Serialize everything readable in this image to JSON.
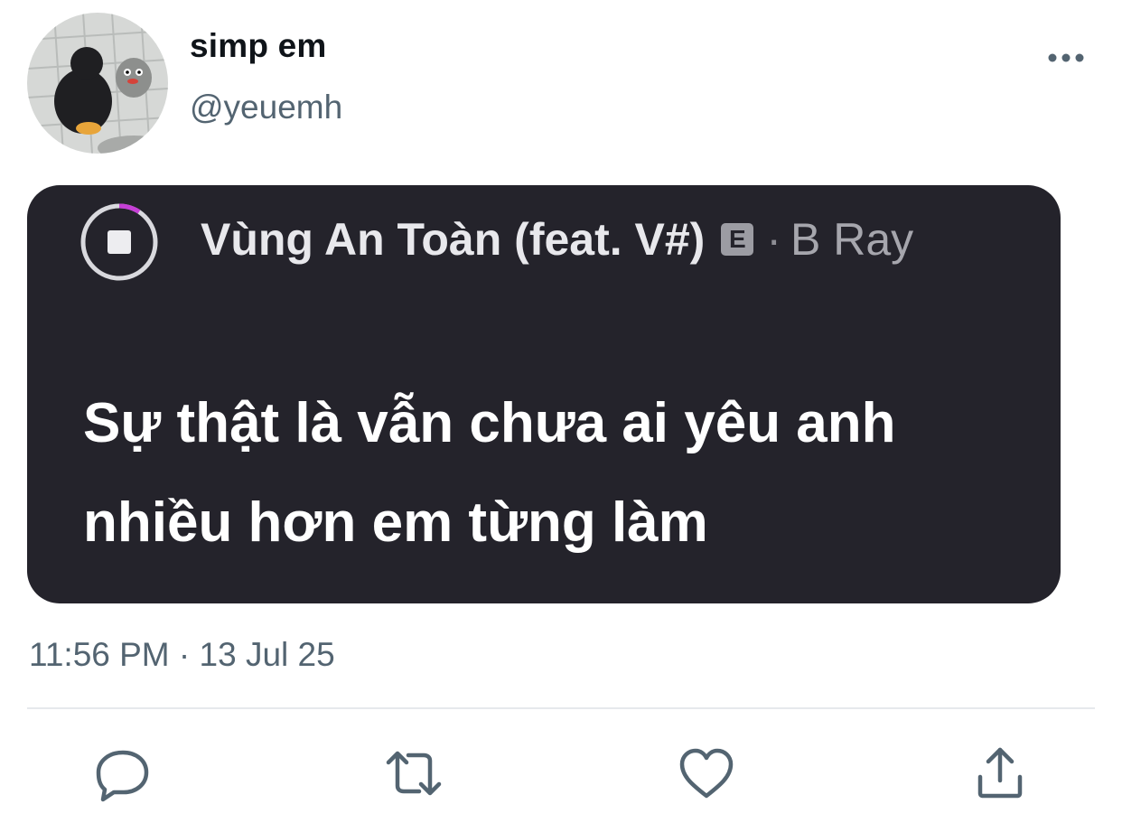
{
  "author": {
    "display_name": "simp em",
    "handle": "@yeuemh",
    "avatar_icon": "avatar-photo-penguin"
  },
  "header": {
    "more_icon": "more-horizontal-icon"
  },
  "media": {
    "now_playing": {
      "status_icon": "stop-icon",
      "song_title": "Vùng An Toàn (feat. V#)",
      "explicit_badge": "E",
      "separator": "·",
      "artist": "B Ray"
    },
    "lyrics": "Sự thật là vẫn chưa ai yêu anh nhiều hơn em từng làm"
  },
  "tweet": {
    "timestamp": "11:56 PM · 13 Jul 25"
  },
  "actions": [
    {
      "name": "reply",
      "icon": "reply-icon"
    },
    {
      "name": "retweet",
      "icon": "retweet-icon"
    },
    {
      "name": "like",
      "icon": "like-icon"
    },
    {
      "name": "share",
      "icon": "share-icon"
    }
  ],
  "colors": {
    "text_primary": "#0f1419",
    "text_secondary": "#536471",
    "card_background": "#24232b",
    "progress_accent": "#c63fd6",
    "icon_gray": "#536471"
  }
}
